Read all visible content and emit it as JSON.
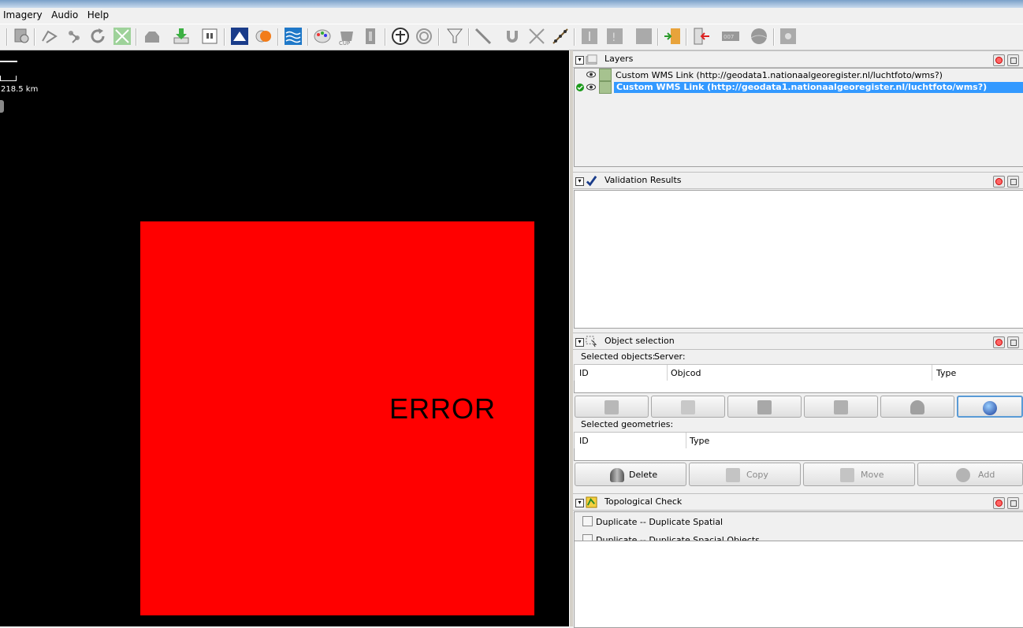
{
  "menu": {
    "items": [
      "Imagery",
      "Audio",
      "Help"
    ]
  },
  "toolbar": {
    "icons": [
      "zoom-icon",
      "wireframe-icon",
      "node-icon",
      "refresh-icon",
      "move-icon",
      "upload-icon",
      "download-icon",
      "wms-icon",
      "osm-icon",
      "globe-icon",
      "water-icon",
      "palette-icon",
      "cup-icon",
      "info-icon",
      "balance-icon",
      "circle-icon",
      "filter-icon",
      "line-icon",
      "magnet-icon",
      "cross-icon",
      "path-icon",
      "info2-icon",
      "warning-icon",
      "text-icon",
      "export-icon",
      "import-icon",
      "counter-icon",
      "hill-icon",
      "gear-icon"
    ]
  },
  "map": {
    "scale_label": "218.5 km",
    "error_text": "ERROR",
    "error_color": "#ff0000"
  },
  "layers": {
    "title": "Layers",
    "items": [
      {
        "name": "Custom WMS Link (http://geodata1.nationaalgeoregister.nl/luchtfoto/wms?)",
        "active": false
      },
      {
        "name": "Custom WMS Link (http://geodata1.nationaalgeoregister.nl/luchtfoto/wms?)",
        "active": true
      }
    ]
  },
  "validation": {
    "title": "Validation Results"
  },
  "object_selection": {
    "title": "Object selection",
    "selected_objects_label": "Selected objects:",
    "server_label": "Server:",
    "objects_columns": [
      "ID",
      "Objcod",
      "Type"
    ],
    "selected_geometries_label": "Selected geometries:",
    "geometry_columns": [
      "ID",
      "Type"
    ],
    "buttons": {
      "delete": "Delete",
      "copy": "Copy",
      "move": "Move",
      "add": "Add"
    }
  },
  "topological": {
    "title": "Topological Check",
    "checks": [
      "Duplicate -- Duplicate Spatial",
      "Duplicate -- Duplicate Spacial Objects"
    ]
  }
}
